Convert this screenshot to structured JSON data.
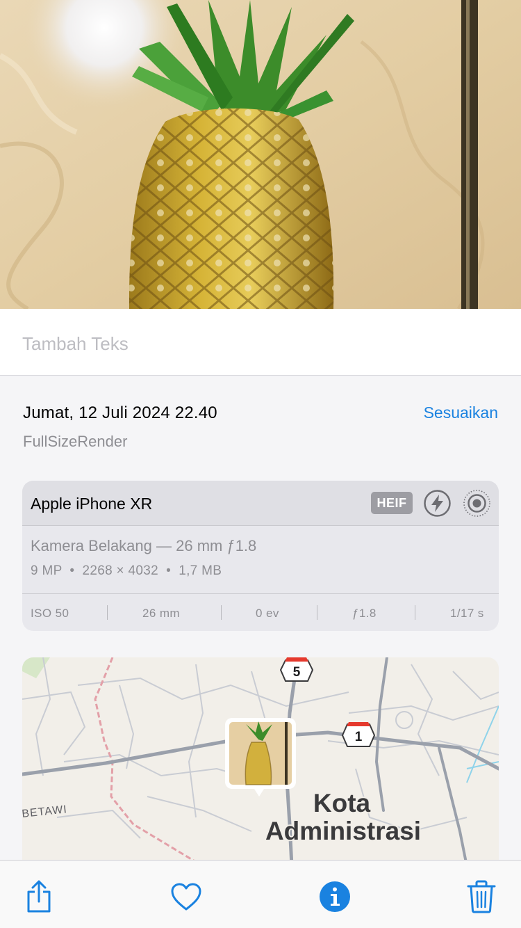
{
  "caption": {
    "placeholder": "Tambah Teks"
  },
  "info": {
    "datetime": "Jumat, 12 Juli 2024 22.40",
    "adjust_label": "Sesuaikan",
    "filename": "FullSizeRender"
  },
  "camera": {
    "device": "Apple iPhone XR",
    "format_badge": "HEIF",
    "lens": "Kamera Belakang — 26 mm ƒ1.8",
    "specs": "9 MP  •  2268 × 4032  •  1,7 MB",
    "exif": {
      "iso": "ISO 50",
      "focal": "26 mm",
      "ev": "0 ev",
      "aperture": "ƒ1.8",
      "shutter": "1/17 s"
    }
  },
  "map": {
    "route_5": "5",
    "route_1": "1",
    "place_line1": "Kota",
    "place_line2": "Administrasi",
    "district": "BETAWI"
  },
  "toolbar": {
    "share": "share-icon",
    "favorite": "heart-icon",
    "info": "info-icon",
    "delete": "trash-icon",
    "accent": "#1a82e0"
  }
}
